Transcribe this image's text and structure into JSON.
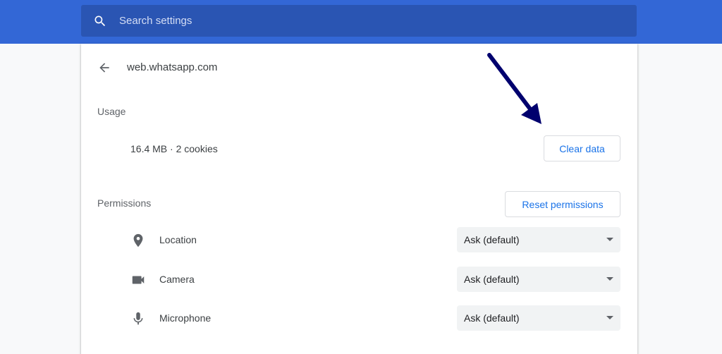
{
  "search": {
    "placeholder": "Search settings",
    "icon": "search-icon"
  },
  "site": {
    "title": "web.whatsapp.com",
    "back_icon": "back-arrow-icon"
  },
  "usage": {
    "label": "Usage",
    "summary": "16.4 MB · 2 cookies",
    "clear_button": "Clear data"
  },
  "permissions": {
    "label": "Permissions",
    "reset_button": "Reset permissions",
    "items": [
      {
        "name": "Location",
        "icon": "location-pin-icon",
        "value": "Ask (default)"
      },
      {
        "name": "Camera",
        "icon": "camera-icon",
        "value": "Ask (default)"
      },
      {
        "name": "Microphone",
        "icon": "microphone-icon",
        "value": "Ask (default)"
      }
    ]
  },
  "colors": {
    "header": "#3367d6",
    "search_bg": "#2a55b3",
    "accent": "#1a73e8",
    "annotation_arrow": "#00006e"
  }
}
